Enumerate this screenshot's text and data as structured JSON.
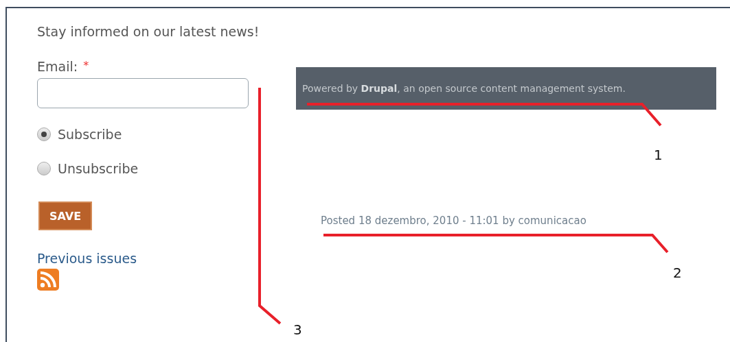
{
  "newsletter": {
    "intro": "Stay informed on our latest news!",
    "email_label": "Email:",
    "required_mark": "*",
    "options": [
      {
        "label": "Subscribe",
        "selected": true
      },
      {
        "label": "Unsubscribe",
        "selected": false
      }
    ],
    "save_button": "SAVE",
    "previous_issues_link": "Previous issues"
  },
  "footer": {
    "text": "Powered by **Drupal**, an open source content management system."
  },
  "post_meta": "Posted 18 dezembro, 2010 - 11:01 by comunicacao",
  "callouts": [
    {
      "number": "1"
    },
    {
      "number": "2"
    },
    {
      "number": "3"
    }
  ]
}
